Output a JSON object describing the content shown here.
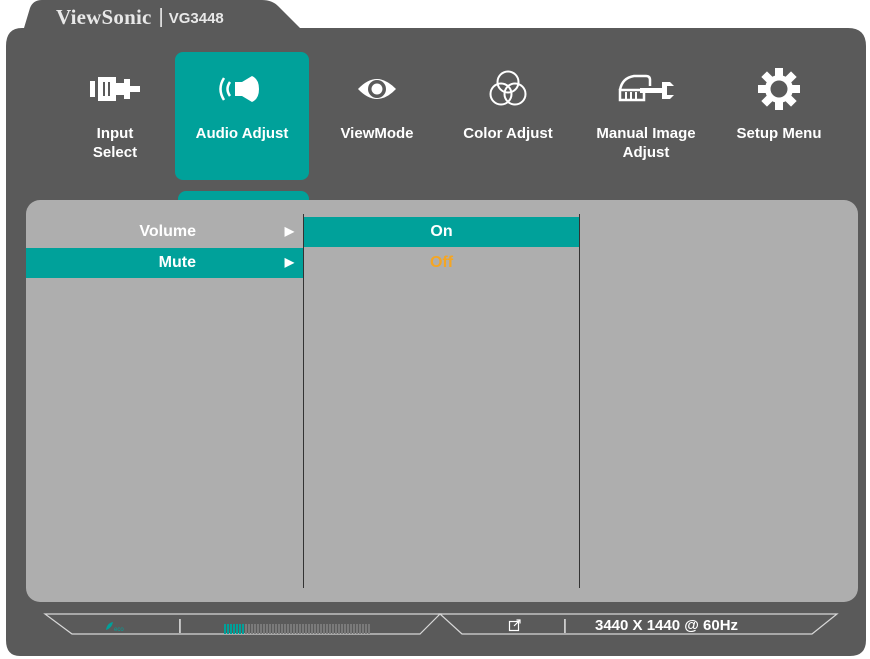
{
  "brand": {
    "name": "ViewSonic",
    "separator": "|",
    "model": "VG3448"
  },
  "menu": [
    {
      "id": "input-select",
      "label": "Input\nSelect",
      "icon": "input-plug-icon",
      "active": false
    },
    {
      "id": "audio-adjust",
      "label": "Audio Adjust",
      "icon": "speaker-icon",
      "active": true
    },
    {
      "id": "viewmode",
      "label": "ViewMode",
      "icon": "eye-icon",
      "active": false
    },
    {
      "id": "color-adjust",
      "label": "Color Adjust",
      "icon": "color-circles-icon",
      "active": false
    },
    {
      "id": "manual-image-adjust",
      "label": "Manual Image\nAdjust",
      "icon": "hand-wrench-icon",
      "active": false
    },
    {
      "id": "setup-menu",
      "label": "Setup Menu",
      "icon": "gear-icon",
      "active": false
    }
  ],
  "submenu": {
    "items": [
      {
        "label": "Volume",
        "arrow": "▶",
        "selected": false
      },
      {
        "label": "Mute",
        "arrow": "▶",
        "selected": true
      }
    ]
  },
  "options": {
    "items": [
      {
        "label": "On",
        "state": "highlight"
      },
      {
        "label": "Off",
        "state": "current"
      }
    ]
  },
  "status": {
    "eco_label": "eco",
    "separator": "|",
    "level_fraction": 0.14,
    "separator2": "|",
    "resolution": "3440 X 1440 @ 60Hz"
  },
  "colors": {
    "frame": "#5a5a5a",
    "accent": "#00a19a",
    "panel": "#aeaeae",
    "current_value": "#f5a623"
  }
}
